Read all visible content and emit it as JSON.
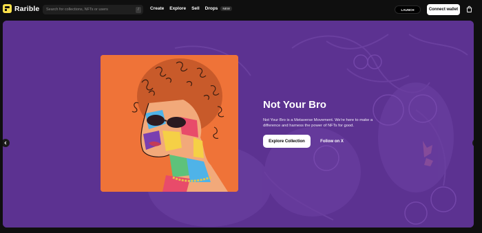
{
  "brand": {
    "name": "Rarible",
    "accent": "#fbe14b"
  },
  "search": {
    "placeholder": "Search for collections, NFTs or users",
    "shortcut": "/"
  },
  "nav": {
    "items": [
      {
        "label": "Create"
      },
      {
        "label": "Explore"
      },
      {
        "label": "Sell"
      },
      {
        "label": "Drops"
      }
    ],
    "drops_badge": "NEW"
  },
  "actions": {
    "launch_label": "LAUNCH",
    "connect_label": "Connect wallet",
    "cart_icon": "shopping-bag-icon"
  },
  "hero": {
    "title": "Not Your Bro",
    "description": "Not Your Bro is a Metaverse Movement. We're here to make a difference and harness the power of NFTs for good.",
    "primary_cta": "Explore Collection",
    "secondary_cta": "Follow on X",
    "background_color": "#5c3291",
    "art_color": "#ef7338"
  }
}
